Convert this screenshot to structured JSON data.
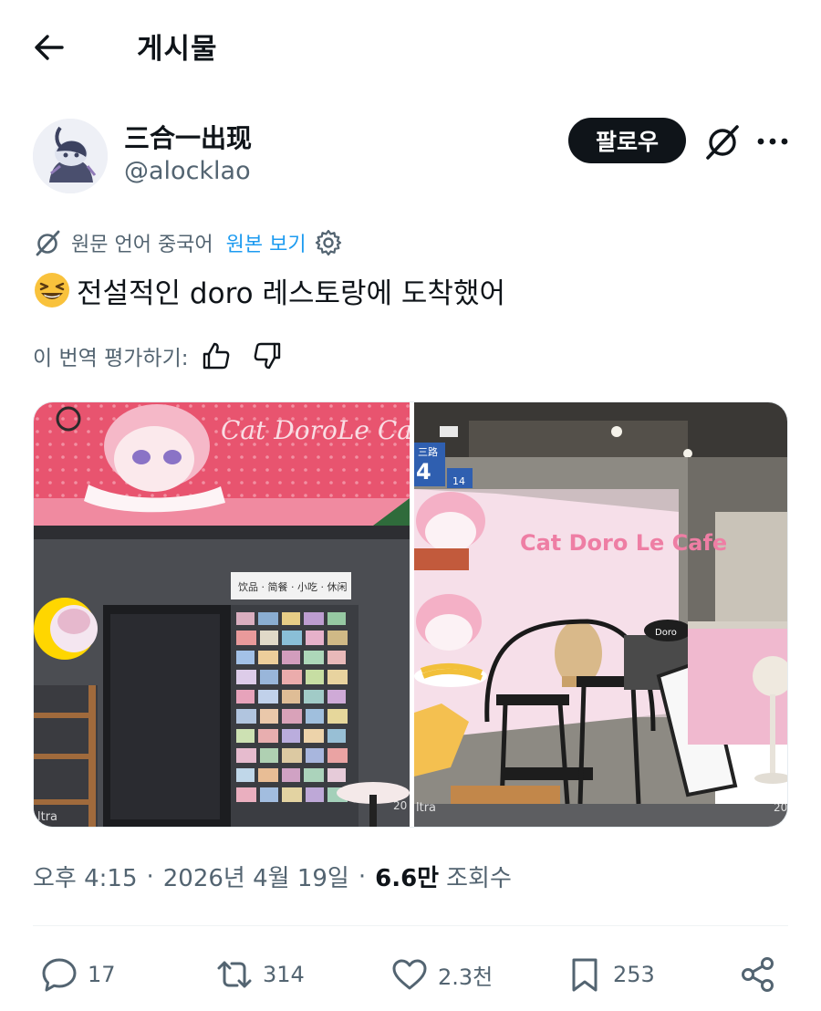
{
  "header": {
    "title": "게시물",
    "back_icon": "arrow-left-icon"
  },
  "author": {
    "display_name": "三合一出现",
    "handle": "@alocklao",
    "follow_label": "팔로우"
  },
  "translation": {
    "note": "원문 언어 중국어",
    "view_original": "원본 보기",
    "rate_label": "이 번역 평가하기:"
  },
  "post": {
    "text": "전설적인 doro 레스토랑에 도착했어",
    "emoji": "grinning-squinting-face"
  },
  "media": {
    "left_sign": "Cat DoroLe Café",
    "left_menu": "饮品 · 简餐 · 小吃 · 休闲",
    "right_sign": "Cat Doro Le Cafe",
    "street_sign": "三路",
    "street_number": "4",
    "street_sub": "14",
    "tag_doro": "Doro",
    "watermark_left": "ltra",
    "watermark_mid": "20",
    "watermark_right_l": "ltra",
    "watermark_right_r": "20"
  },
  "meta": {
    "time": "오후 4:15",
    "date": "2026년 4월 19일",
    "views_count": "6.6만",
    "views_label": "조회수"
  },
  "actions": {
    "replies": "17",
    "reposts": "314",
    "likes": "2.3천",
    "bookmarks": "253"
  },
  "colors": {
    "text": "#0f1419",
    "muted": "#536471",
    "link": "#1d9bf0",
    "button_bg": "#0f1419"
  }
}
